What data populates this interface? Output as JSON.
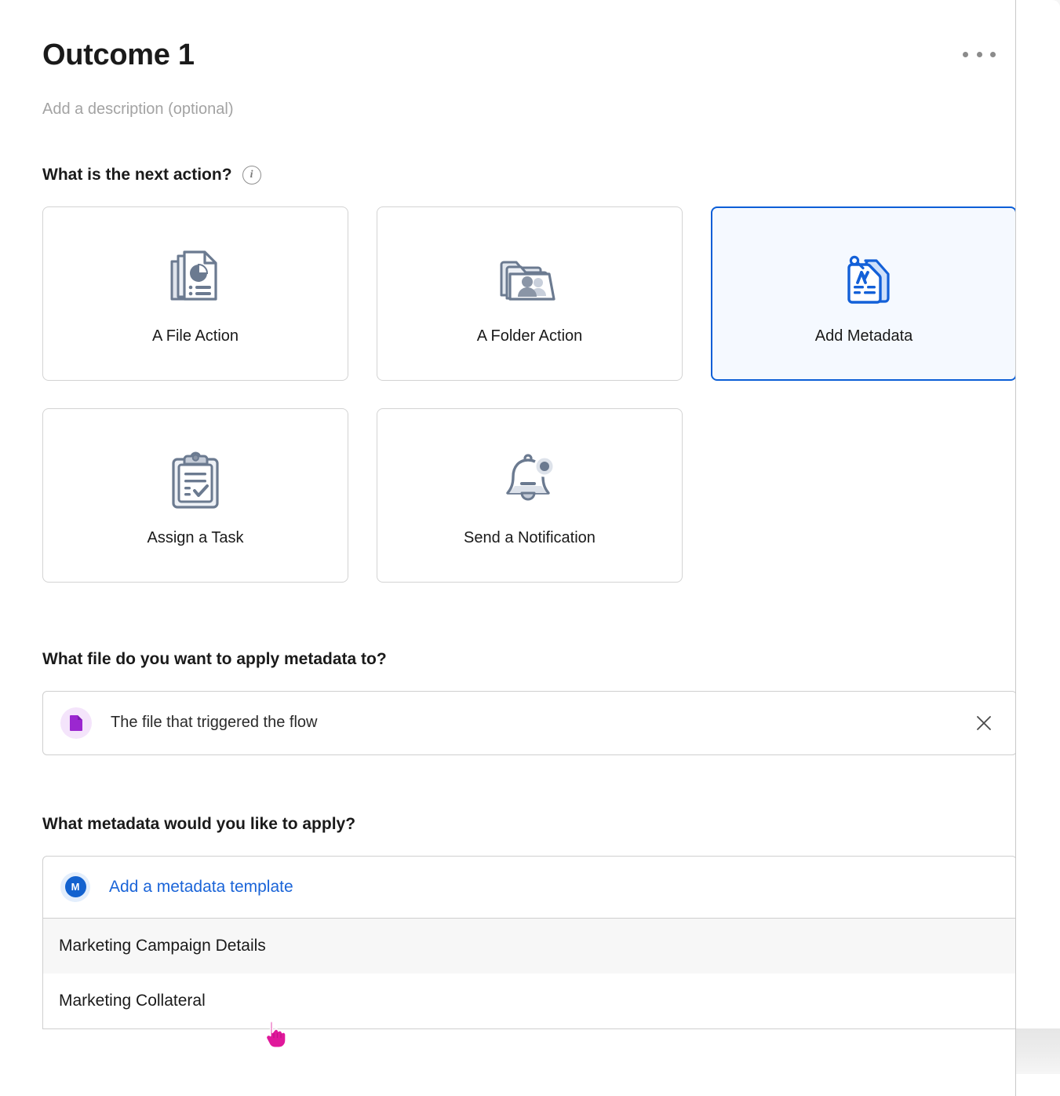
{
  "header": {
    "title": "Outcome 1",
    "description_placeholder": "Add a description (optional)",
    "menu_icon": "more-horizontal-icon"
  },
  "sections": {
    "action": {
      "heading": "What is the next action?",
      "info_icon": "info-circle-icon",
      "cards": [
        {
          "label": "A File Action",
          "icon": "file-chart-icon",
          "selected": false
        },
        {
          "label": "A Folder Action",
          "icon": "folder-people-icon",
          "selected": false
        },
        {
          "label": "Add Metadata",
          "icon": "metadata-tag-icon",
          "selected": true
        },
        {
          "label": "Assign a Task",
          "icon": "clipboard-check-icon",
          "selected": false
        },
        {
          "label": "Send a Notification",
          "icon": "bell-badge-icon",
          "selected": false
        }
      ]
    },
    "file_target": {
      "heading": "What file do you want to apply metadata to?",
      "value": "The file that triggered the flow",
      "value_icon": "file-purple-icon",
      "clear_icon": "close-x-icon"
    },
    "metadata": {
      "heading": "What metadata would you like to apply?",
      "add_link": "Add a metadata template",
      "add_icon": "metadata-m-badge-icon",
      "options": [
        {
          "label": "Marketing Campaign Details",
          "hovered": true
        },
        {
          "label": "Marketing Collateral",
          "hovered": false
        }
      ]
    }
  },
  "cursor": {
    "icon": "pointer-hand-cursor",
    "color": "#e0189b"
  },
  "colors": {
    "accent_blue": "#0b5ed7",
    "link_blue": "#1a64d8",
    "selected_card_bg": "#f5f9ff",
    "icon_gray": "#6b7a90",
    "file_purple": "#9b27d0",
    "border_gray": "#cfcfcf",
    "hover_gray": "#f7f7f7"
  }
}
